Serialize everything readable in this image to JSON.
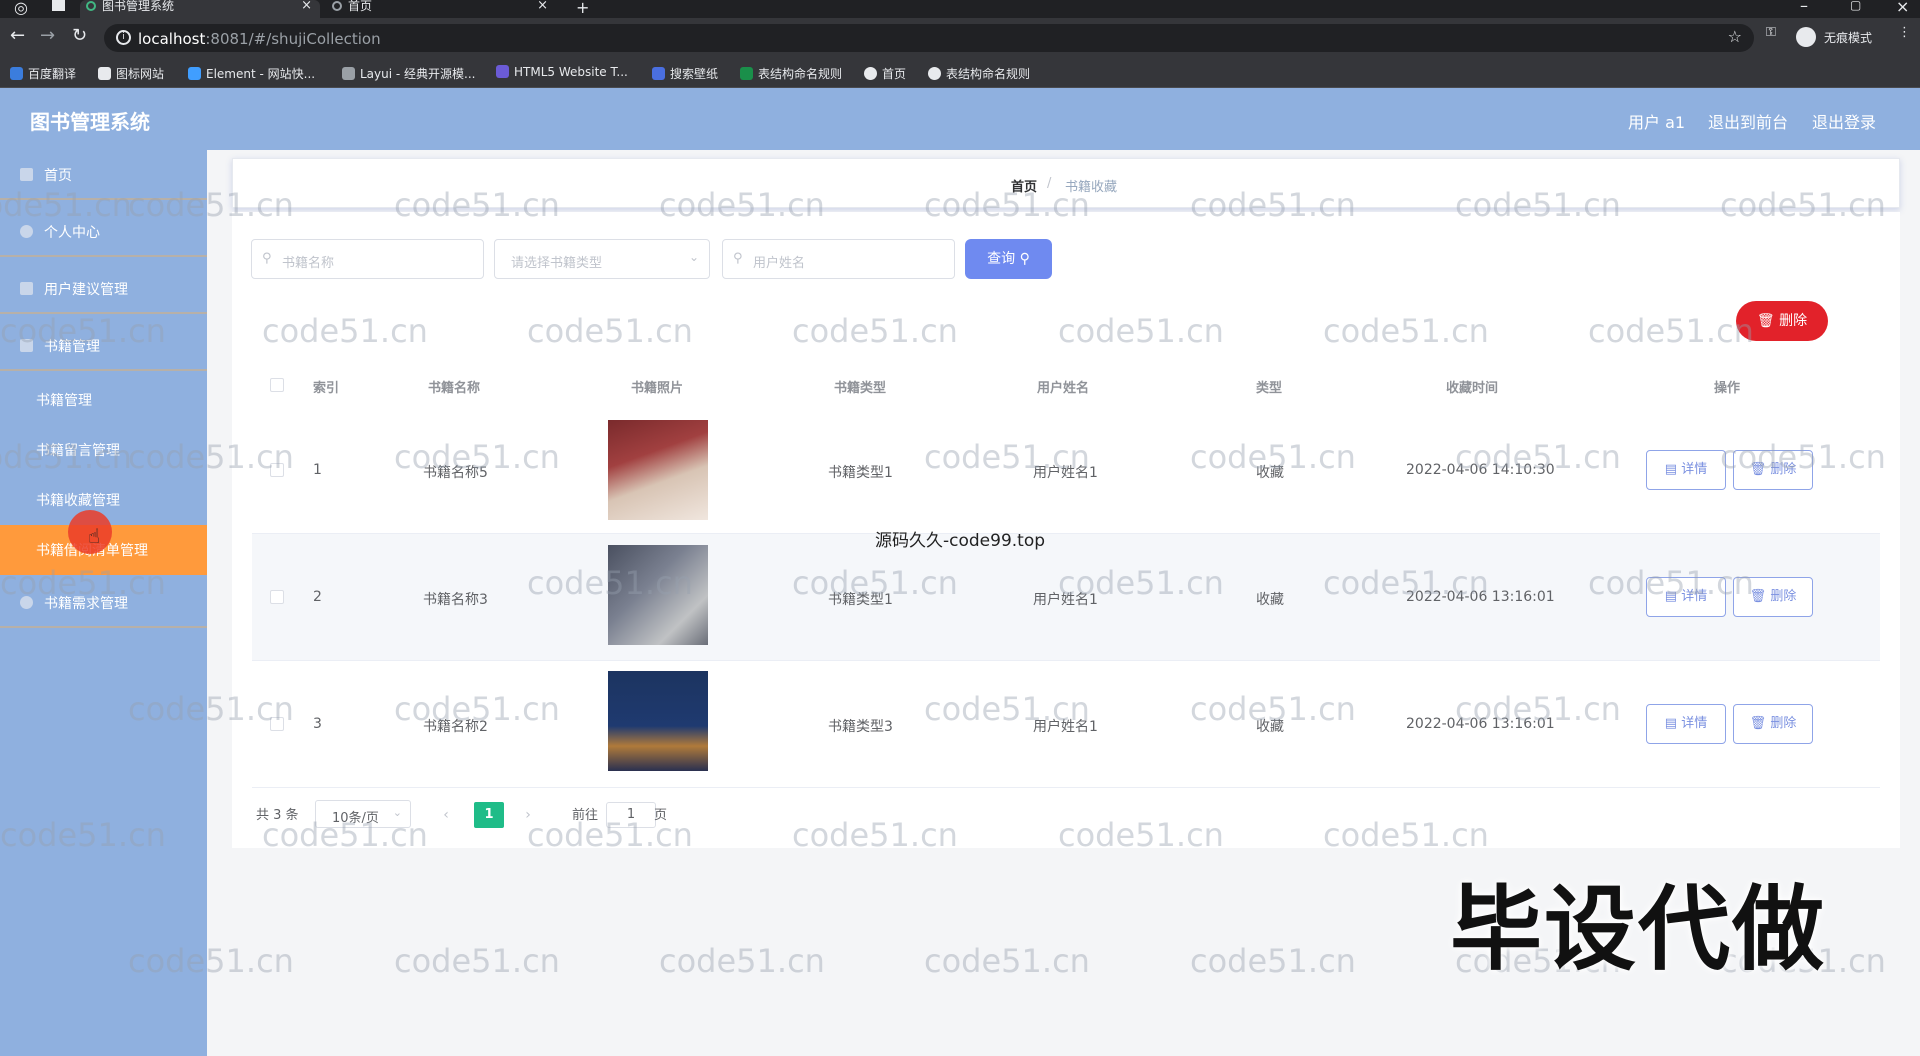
{
  "browser": {
    "tabs": [
      {
        "title": "图书管理系统",
        "active": true
      },
      {
        "title": "首页",
        "active": false
      }
    ],
    "url": {
      "host": "localhost",
      "rest": ":8081/#/shujiCollection"
    },
    "incognito_label": "无痕模式",
    "bookmarks": [
      "百度翻译",
      "图标网站",
      "Element - 网站快...",
      "Layui - 经典开源模...",
      "HTML5 Website T...",
      "搜索壁纸",
      "表结构命名规则",
      "首页",
      "表结构命名规则"
    ]
  },
  "header": {
    "title": "图书管理系统",
    "user": "用户 a1",
    "back_front": "退出到前台",
    "logout": "退出登录"
  },
  "sidebar": {
    "items": [
      {
        "label": "首页"
      },
      {
        "label": "个人中心"
      },
      {
        "label": "用户建议管理"
      },
      {
        "label": "书籍管理"
      }
    ],
    "sub_items": [
      {
        "label": "书籍管理"
      },
      {
        "label": "书籍留言管理"
      },
      {
        "label": "书籍收藏管理"
      },
      {
        "label": "书籍借阅清单管理"
      }
    ],
    "last_item": {
      "label": "书籍需求管理"
    }
  },
  "breadcrumb": {
    "home": "首页",
    "sep": "/",
    "current": "书籍收藏"
  },
  "search": {
    "book_name_placeholder": "书籍名称",
    "type_placeholder": "请选择书籍类型",
    "user_placeholder": "用户姓名",
    "query_label": "查询"
  },
  "delete_label": "删除",
  "table": {
    "headers": [
      "索引",
      "书籍名称",
      "书籍照片",
      "书籍类型",
      "用户姓名",
      "类型",
      "收藏时间",
      "操作"
    ],
    "rows": [
      {
        "index": "1",
        "name": "书籍名称5",
        "type": "书籍类型1",
        "user": "用户姓名1",
        "kind": "收藏",
        "time": "2022-04-06 14:10:30"
      },
      {
        "index": "2",
        "name": "书籍名称3",
        "type": "书籍类型1",
        "user": "用户姓名1",
        "kind": "收藏",
        "time": "2022-04-06 13:16:01"
      },
      {
        "index": "3",
        "name": "书籍名称2",
        "type": "书籍类型3",
        "user": "用户姓名1",
        "kind": "收藏",
        "time": "2022-04-06 13:16:01"
      }
    ],
    "detail_label": "详情",
    "delete_label": "删除"
  },
  "pagination": {
    "total": "共 3 条",
    "page_size": "10条/页",
    "current_page": "1",
    "goto_label": "前往",
    "goto_value": "1",
    "page_suffix": "页"
  },
  "overlay": {
    "watermark": "code51.cn",
    "middle_text": "源码久久-code99.top",
    "caption": "毕设代做"
  },
  "colors": {
    "header_bg": "#8fb0df",
    "active_menu": "#ff9a3c",
    "query_button": "#6f8af0",
    "delete_button": "#e2222a",
    "current_page": "#1fbc88"
  }
}
